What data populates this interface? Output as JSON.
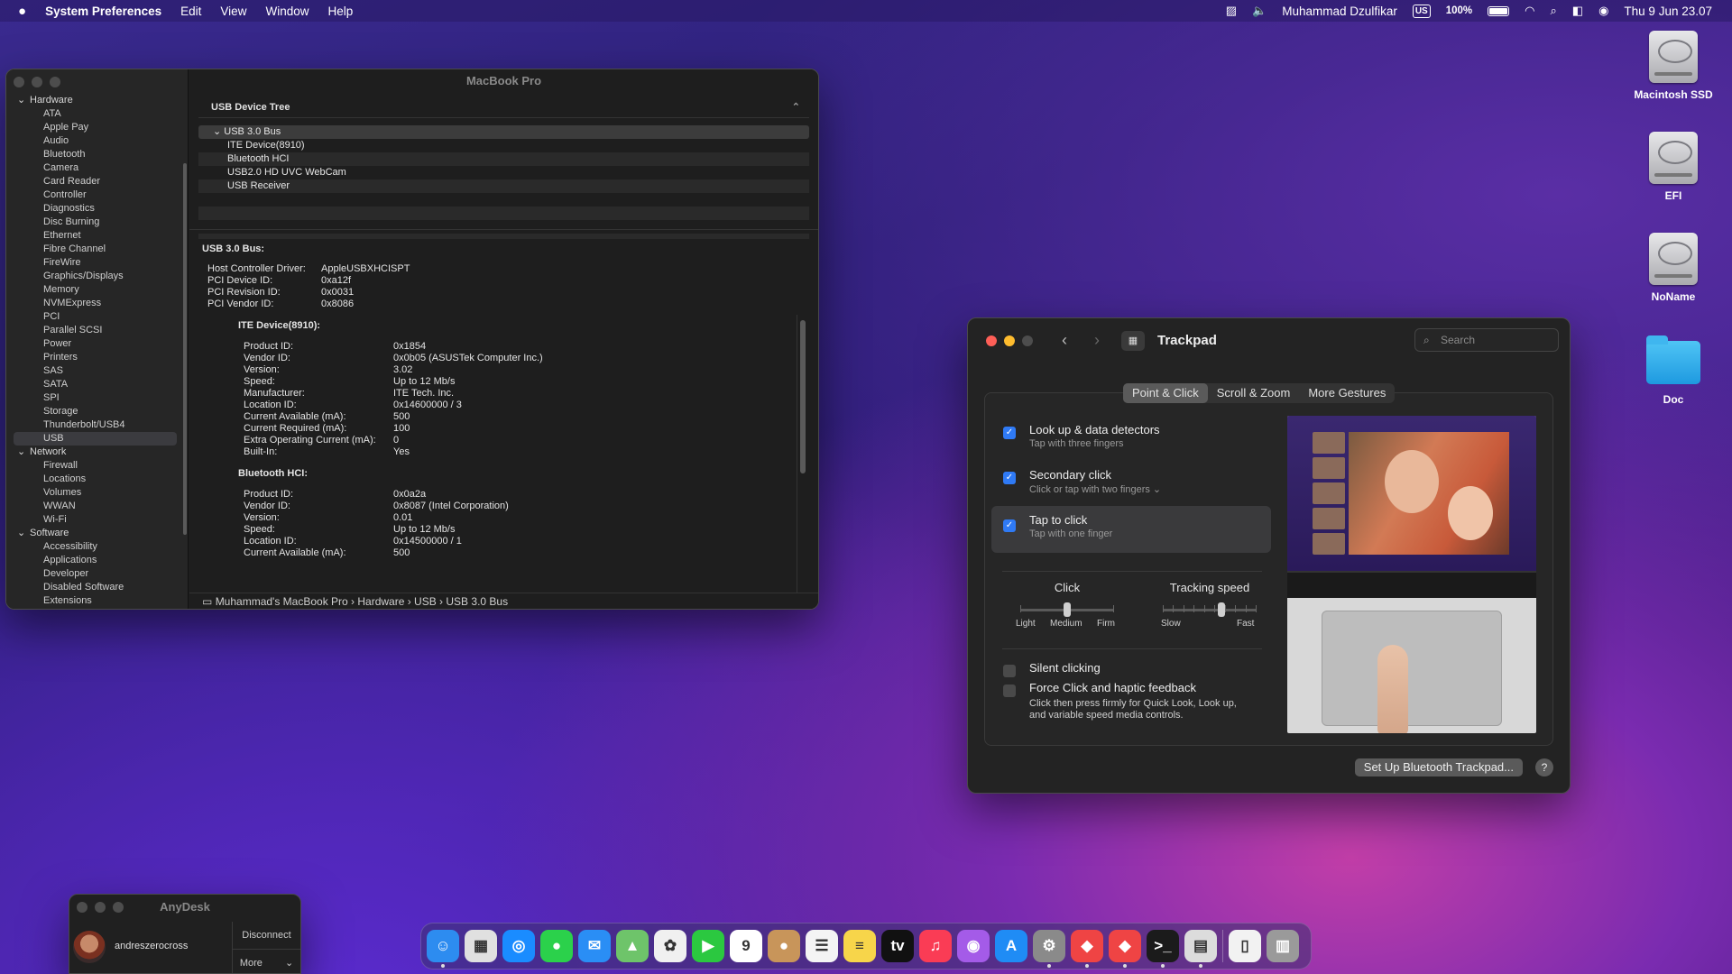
{
  "menubar": {
    "apple": "",
    "app": "System Preferences",
    "menus": [
      "Edit",
      "View",
      "Window",
      "Help"
    ],
    "user": "Muhammad Dzulfikar",
    "input_source": "US",
    "battery": "100%",
    "clock": "Thu 9 Jun  23.07"
  },
  "desktop": {
    "icons": [
      "Macintosh SSD",
      "EFI",
      "NoName",
      "Doc"
    ]
  },
  "sysinfo": {
    "title": "MacBook Pro",
    "sidebar": {
      "hardware": "Hardware",
      "hardware_items": [
        "ATA",
        "Apple Pay",
        "Audio",
        "Bluetooth",
        "Camera",
        "Card Reader",
        "Controller",
        "Diagnostics",
        "Disc Burning",
        "Ethernet",
        "Fibre Channel",
        "FireWire",
        "Graphics/Displays",
        "Memory",
        "NVMExpress",
        "PCI",
        "Parallel SCSI",
        "Power",
        "Printers",
        "SAS",
        "SATA",
        "SPI",
        "Storage",
        "Thunderbolt/USB4",
        "USB"
      ],
      "selected": "USB",
      "network": "Network",
      "network_items": [
        "Firewall",
        "Locations",
        "Volumes",
        "WWAN",
        "Wi-Fi"
      ],
      "software": "Software",
      "software_items": [
        "Accessibility",
        "Applications",
        "Developer",
        "Disabled Software",
        "Extensions"
      ]
    },
    "tree_header": "USB Device Tree",
    "tree": {
      "bus": "USB 3.0 Bus",
      "devices": [
        "ITE Device(8910)",
        "Bluetooth HCI",
        "USB2.0 HD UVC WebCam",
        "USB Receiver"
      ]
    },
    "detail": {
      "heading": "USB 3.0 Bus:",
      "bus_props": [
        {
          "k": "Host Controller Driver:",
          "v": "AppleUSBXHCISPT"
        },
        {
          "k": "PCI Device ID:",
          "v": "0xa12f"
        },
        {
          "k": "PCI Revision ID:",
          "v": "0x0031"
        },
        {
          "k": "PCI Vendor ID:",
          "v": "0x8086"
        }
      ],
      "dev1_title": "ITE Device(8910):",
      "dev1_props": [
        {
          "k": "Product ID:",
          "v": "0x1854"
        },
        {
          "k": "Vendor ID:",
          "v": "0x0b05  (ASUSTek Computer Inc.)"
        },
        {
          "k": "Version:",
          "v": "3.02"
        },
        {
          "k": "Speed:",
          "v": "Up to 12 Mb/s"
        },
        {
          "k": "Manufacturer:",
          "v": "ITE Tech. Inc."
        },
        {
          "k": "Location ID:",
          "v": "0x14600000 / 3"
        },
        {
          "k": "Current Available (mA):",
          "v": "500"
        },
        {
          "k": "Current Required (mA):",
          "v": "100"
        },
        {
          "k": "Extra Operating Current (mA):",
          "v": "0"
        },
        {
          "k": "Built-In:",
          "v": "Yes"
        }
      ],
      "dev2_title": "Bluetooth HCI:",
      "dev2_props": [
        {
          "k": "Product ID:",
          "v": "0x0a2a"
        },
        {
          "k": "Vendor ID:",
          "v": "0x8087  (Intel Corporation)"
        },
        {
          "k": "Version:",
          "v": "0.01"
        },
        {
          "k": "Speed:",
          "v": "Up to 12 Mb/s"
        },
        {
          "k": "Location ID:",
          "v": "0x14500000 / 1"
        },
        {
          "k": "Current Available (mA):",
          "v": "500"
        }
      ]
    },
    "path": "Muhammad's MacBook Pro  ›  Hardware  ›  USB  ›  USB 3.0 Bus"
  },
  "trackpad": {
    "title": "Trackpad",
    "search_placeholder": "Search",
    "tabs": [
      "Point & Click",
      "Scroll & Zoom",
      "More Gestures"
    ],
    "active_tab": "Point & Click",
    "options": [
      {
        "title": "Look up & data detectors",
        "sub": "Tap with three fingers",
        "checked": true
      },
      {
        "title": "Secondary click",
        "sub": "Click or tap with two fingers ⌄",
        "checked": true
      },
      {
        "title": "Tap to click",
        "sub": "Tap with one finger",
        "checked": true
      }
    ],
    "click_slider": {
      "label": "Click",
      "ticks": [
        "Light",
        "Medium",
        "Firm"
      ],
      "value": "Medium"
    },
    "speed_slider": {
      "label": "Tracking speed",
      "min": "Slow",
      "max": "Fast",
      "level": 0.65
    },
    "silent_clicking": {
      "label": "Silent clicking",
      "checked": false
    },
    "force_click": {
      "label": "Force Click and haptic feedback",
      "checked": false,
      "desc1": "Click then press firmly for Quick Look, Look up,",
      "desc2": "and variable speed media controls."
    },
    "setup_button": "Set Up Bluetooth Trackpad...",
    "help": "?"
  },
  "anydesk": {
    "title": "AnyDesk",
    "user": "andreszerocross",
    "disconnect": "Disconnect",
    "more": "More"
  },
  "dock": {
    "apps": [
      {
        "name": "finder",
        "color": "#2d8cf0",
        "glyph": "☺"
      },
      {
        "name": "launchpad",
        "color": "#e0e0e0",
        "glyph": "▦"
      },
      {
        "name": "safari",
        "color": "#1a8cff",
        "glyph": "◎"
      },
      {
        "name": "messages",
        "color": "#2bd14b",
        "glyph": "●"
      },
      {
        "name": "mail",
        "color": "#2a8ef5",
        "glyph": "✉"
      },
      {
        "name": "maps",
        "color": "#6ec46a",
        "glyph": "▲"
      },
      {
        "name": "photos",
        "color": "#f0f0f0",
        "glyph": "✿"
      },
      {
        "name": "facetime",
        "color": "#2bc840",
        "glyph": "▶"
      },
      {
        "name": "calendar",
        "color": "#ffffff",
        "glyph": "9"
      },
      {
        "name": "contacts",
        "color": "#c8955a",
        "glyph": "●"
      },
      {
        "name": "reminders",
        "color": "#f4f4f4",
        "glyph": "☰"
      },
      {
        "name": "notes",
        "color": "#f7d54a",
        "glyph": "≡"
      },
      {
        "name": "tv",
        "color": "#111111",
        "glyph": "tv"
      },
      {
        "name": "music",
        "color": "#fa3c55",
        "glyph": "♫"
      },
      {
        "name": "podcasts",
        "color": "#a45be8",
        "glyph": "◉"
      },
      {
        "name": "app-store",
        "color": "#1f8cf5",
        "glyph": "A"
      },
      {
        "name": "system-preferences",
        "color": "#8a8a8a",
        "glyph": "⚙"
      },
      {
        "name": "anydesk",
        "color": "#ef4444",
        "glyph": "◆"
      },
      {
        "name": "anydesk-2",
        "color": "#ef4444",
        "glyph": "◆"
      },
      {
        "name": "terminal",
        "color": "#1b1b1b",
        "glyph": ">_"
      },
      {
        "name": "system-information",
        "color": "#dcdcdc",
        "glyph": "▤"
      }
    ],
    "right": [
      {
        "name": "document",
        "color": "#f2f2f2",
        "glyph": "▯"
      },
      {
        "name": "trash",
        "color": "#9a9a9a",
        "glyph": "▥"
      }
    ]
  }
}
